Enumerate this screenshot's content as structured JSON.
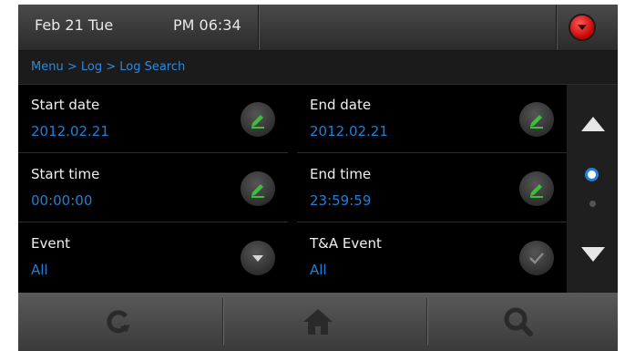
{
  "header": {
    "date": "Feb 21 Tue",
    "time": "PM 06:34",
    "status_color": "#e00000"
  },
  "breadcrumb": {
    "path": "Menu > Log > Log Search"
  },
  "fields": [
    {
      "label": "Start date",
      "value": "2012.02.21",
      "action_icon": "edit-pencil-icon"
    },
    {
      "label": "End date",
      "value": "2012.02.21",
      "action_icon": "edit-pencil-icon"
    },
    {
      "label": "Start time",
      "value": "00:00:00",
      "action_icon": "edit-pencil-icon"
    },
    {
      "label": "End time",
      "value": "23:59:59",
      "action_icon": "edit-pencil-icon"
    },
    {
      "label": "Event",
      "value": "All",
      "action_icon": "dropdown-icon"
    },
    {
      "label": "T&A Event",
      "value": "All",
      "action_icon": "check-icon"
    }
  ],
  "pager": {
    "pages": 2,
    "current": 1
  },
  "toolbar": {
    "buttons": [
      "refresh-icon",
      "home-icon",
      "search-icon"
    ]
  },
  "colors": {
    "accent": "#1f7fd6",
    "edit_green": "#3cbf3c"
  }
}
